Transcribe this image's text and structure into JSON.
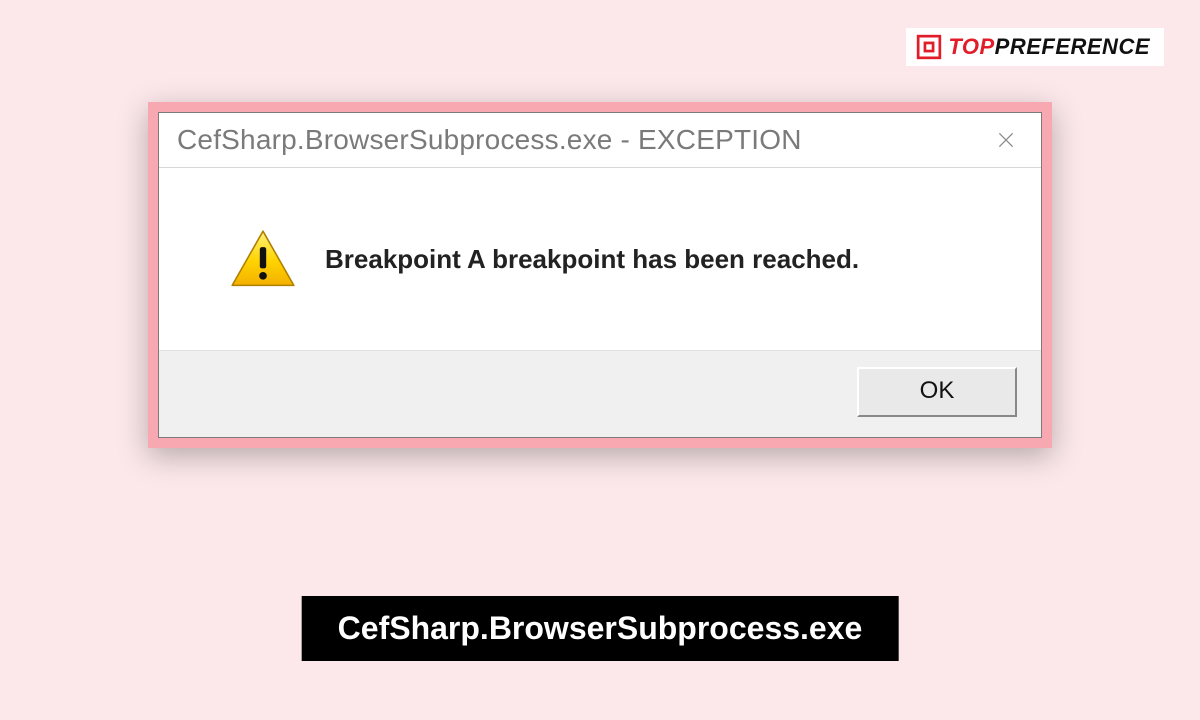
{
  "watermark": {
    "prefix": "TOP",
    "suffix": "PREFERENCE"
  },
  "dialog": {
    "title": "CefSharp.BrowserSubprocess.exe - EXCEPTION",
    "message": "Breakpoint A breakpoint has been reached.",
    "ok_label": "OK"
  },
  "caption": "CefSharp.BrowserSubprocess.exe"
}
